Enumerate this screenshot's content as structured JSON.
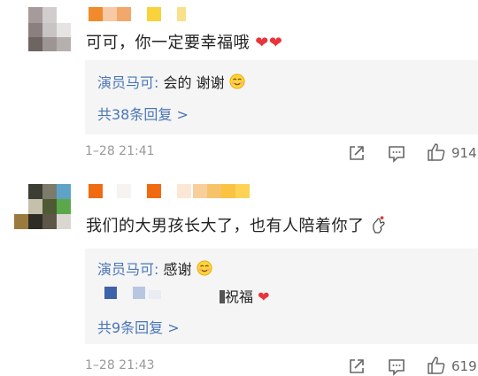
{
  "comments": [
    {
      "text": "可可，你一定要幸福哦",
      "emoji_after": "heart-emoji x2",
      "reply_preview": {
        "author": "演员马可",
        "separator": ": ",
        "text": "会的 谢谢"
      },
      "more_replies": "共38条回复 >",
      "time": "1–28 21:41",
      "likes": "914"
    },
    {
      "text": "我们的大男孩长大了，也有人陪着你了",
      "emoji_after": "finger-heart-emoji",
      "reply_preview": {
        "author": "演员马可",
        "separator": ": ",
        "text": "感谢"
      },
      "reply_preview_2": {
        "text": "祝福"
      },
      "more_replies": "共9条回复 >",
      "time": "1–28 21:43",
      "likes": "619"
    }
  ],
  "colors": {
    "link_blue": "#4a76b8",
    "heart_red": "#e8343a",
    "time_gray": "#9a9a9a",
    "reply_bg": "#f5f5f5"
  }
}
